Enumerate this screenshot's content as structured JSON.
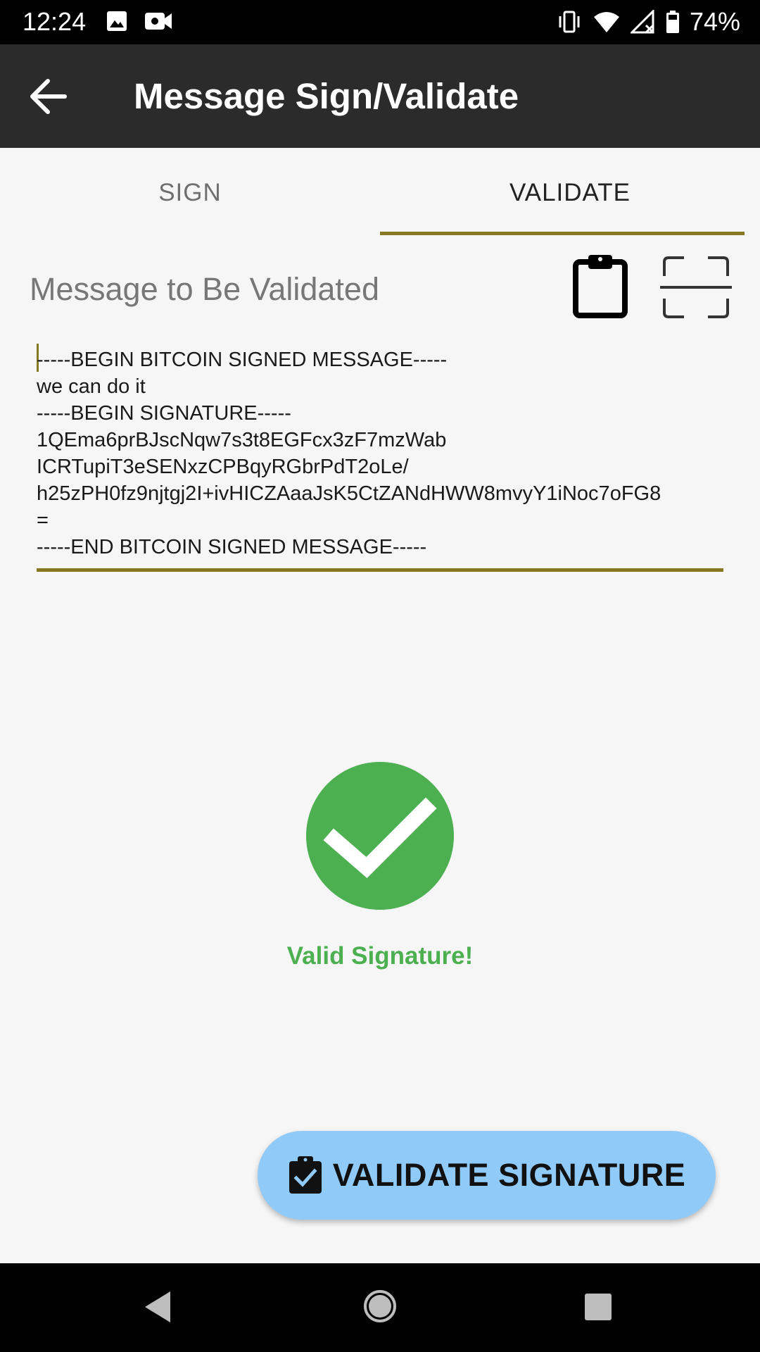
{
  "status_bar": {
    "time": "12:24",
    "battery": "74%",
    "icons_left": [
      "image-icon",
      "video-camera-icon"
    ],
    "icons_right": [
      "vibrate-icon",
      "wifi-icon",
      "signal-icon",
      "battery-icon"
    ]
  },
  "app_bar": {
    "title": "Message Sign/Validate",
    "back_icon": "arrow-back-icon"
  },
  "tabs": {
    "sign_label": "SIGN",
    "validate_label": "VALIDATE",
    "active": "VALIDATE"
  },
  "message": {
    "label": "Message to Be Validated",
    "text": "-----BEGIN BITCOIN SIGNED MESSAGE-----\nwe can do it\n-----BEGIN SIGNATURE-----\n1QEma6prBJscNqw7s3t8EGFcx3zF7mzWab\nICRTupiT3eSENxzCPBqyRGbrPdT2oLe/\nh25zPH0fz9njtgj2I+ivHICZAaaJsK5CtZANdHWW8mvyY1iNoc7oFG8\n=\n-----END BITCOIN SIGNED MESSAGE-----"
  },
  "result": {
    "text": "Valid Signature!",
    "icon": "check-circle-icon"
  },
  "actions": {
    "validate_label": "VALIDATE SIGNATURE"
  },
  "colors": {
    "accent": "#857820",
    "app_bar": "#2b2b2b",
    "success": "#4caf50",
    "button": "#90caf9"
  }
}
